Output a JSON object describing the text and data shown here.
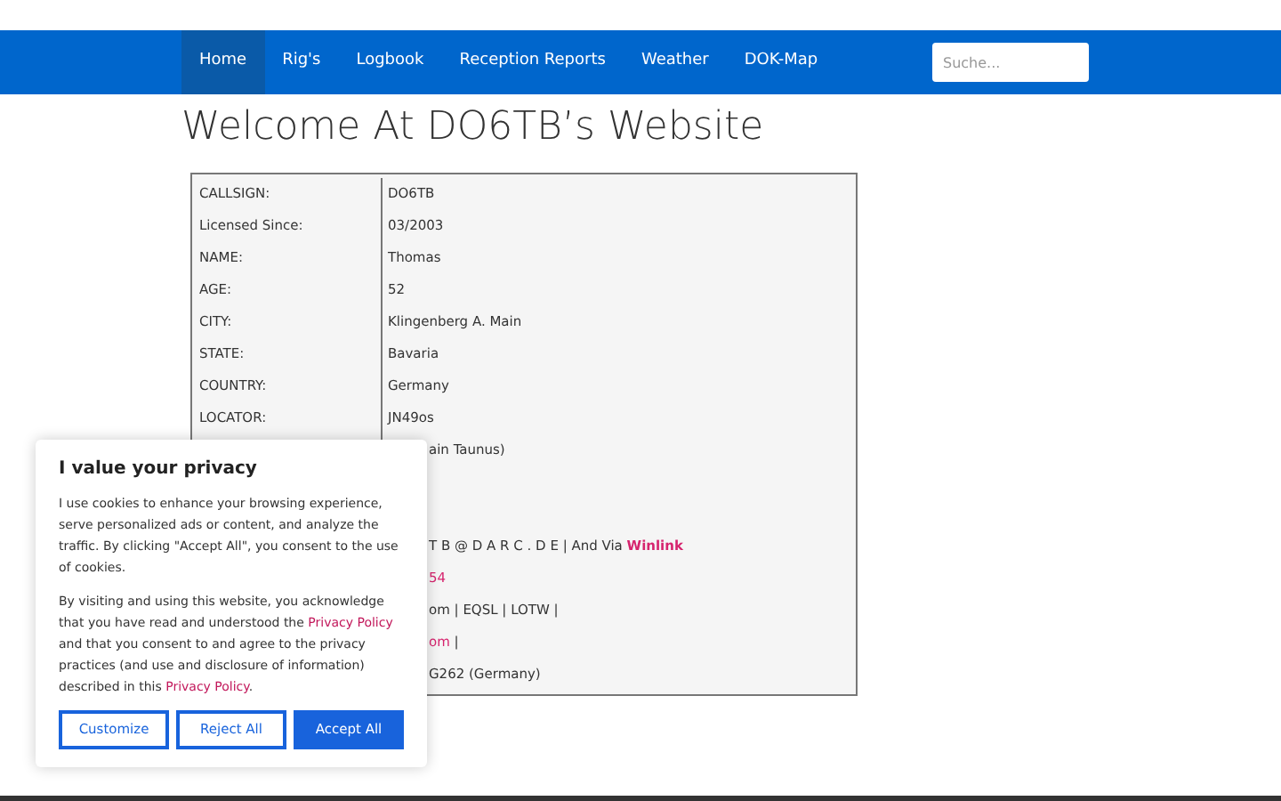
{
  "nav": {
    "items": [
      {
        "label": "Home",
        "selected": true
      },
      {
        "label": "Rig's",
        "selected": false
      },
      {
        "label": "Logbook",
        "selected": false
      },
      {
        "label": "Reception Reports",
        "selected": false
      },
      {
        "label": "Weather",
        "selected": false
      },
      {
        "label": "DOK-Map",
        "selected": false
      }
    ],
    "search": {
      "placeholder": "Suche..."
    }
  },
  "title": "Welcome At DO6TB’s Website",
  "table": {
    "rows": [
      {
        "label": "CALLSIGN:",
        "value": [
          {
            "text": "DO6TB"
          }
        ]
      },
      {
        "label": "Licensed Since:",
        "value": [
          {
            "text": "03/2003"
          }
        ]
      },
      {
        "label": "NAME:",
        "value": [
          {
            "text": "Thomas"
          }
        ]
      },
      {
        "label": "AGE:",
        "value": [
          {
            "text": "52"
          }
        ]
      },
      {
        "label": "CITY:",
        "value": [
          {
            "text": "Klingenberg A. Main"
          }
        ]
      },
      {
        "label": "STATE:",
        "value": [
          {
            "text": "Bavaria"
          }
        ]
      },
      {
        "label": "COUNTRY:",
        "value": [
          {
            "text": "Germany"
          }
        ]
      },
      {
        "label": "LOCATOR:",
        "value": [
          {
            "text": "JN49os"
          }
        ]
      },
      {
        "partial": true,
        "value": [
          {
            "text": "ain Taunus)"
          }
        ]
      },
      {},
      {},
      {
        "partial": true,
        "value": [
          {
            "text": "T B @ D A R C . D E | And Via "
          },
          {
            "text": "Winlink",
            "link": true,
            "bold": true
          }
        ]
      },
      {
        "partial": true,
        "value": [
          {
            "text": "54",
            "link": true
          }
        ]
      },
      {
        "partial": true,
        "value": [
          {
            "text": "om | EQSL | LOTW |"
          }
        ]
      },
      {
        "partial": true,
        "value": [
          {
            "text": "om",
            "link": true
          },
          {
            "text": " |"
          }
        ]
      },
      {
        "partial": true,
        "value": [
          {
            "text": "G262 (Germany)"
          }
        ]
      }
    ]
  },
  "cookie_banner": {
    "title": "I value your privacy",
    "paragraphs": [
      [
        {
          "text": "I use cookies to enhance your browsing experience, serve personalized ads or content, and analyze the traffic. By clicking \"Accept All\", you consent to the use of cookies."
        }
      ],
      [
        {
          "text": "By visiting and using this website, you acknowledge that you have read and understood the "
        },
        {
          "text": "Privacy Policy",
          "link": true
        },
        {
          "text": " and that you consent to and agree to the privacy practices (and use and disclosure of information) described in this "
        },
        {
          "text": "Privacy Policy",
          "link": true
        },
        {
          "text": "."
        }
      ]
    ],
    "buttons": [
      {
        "label": "Customize",
        "kind": "outline"
      },
      {
        "label": "Reject All",
        "kind": "outline"
      },
      {
        "label": "Accept All",
        "kind": "primary"
      }
    ]
  }
}
